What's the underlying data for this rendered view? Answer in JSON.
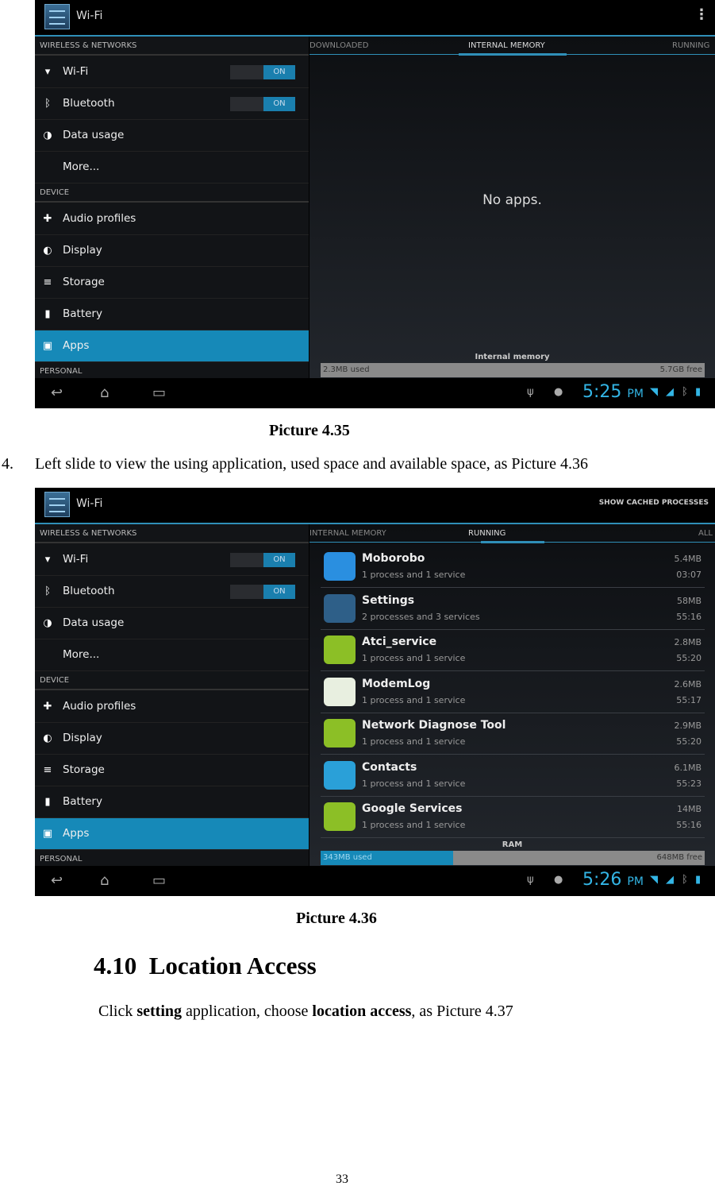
{
  "screens": [
    {
      "title": "Wi-Fi",
      "action": "⋮",
      "left_header": "WIRELESS & NETWORKS",
      "wifi": "Wi-Fi",
      "bluetooth": "Bluetooth",
      "toggle_on": "ON",
      "data_usage": "Data usage",
      "more": "More...",
      "device_header": "DEVICE",
      "audio": "Audio profiles",
      "display": "Display",
      "storage": "Storage",
      "battery": "Battery",
      "apps": "Apps",
      "personal_header": "PERSONAL",
      "tabs": [
        "DOWNLOADED",
        "INTERNAL MEMORY",
        "RUNNING"
      ],
      "selected_tab": 1,
      "empty": "No apps.",
      "bar_label": "Internal memory",
      "used": "2.3MB used",
      "free": "5.7GB free",
      "used_fraction": 0.0,
      "time": "5:25",
      "ampm": "PM"
    },
    {
      "title": "Wi-Fi",
      "action": "SHOW CACHED PROCESSES",
      "left_header": "WIRELESS & NETWORKS",
      "wifi": "Wi-Fi",
      "bluetooth": "Bluetooth",
      "toggle_on": "ON",
      "data_usage": "Data usage",
      "more": "More...",
      "device_header": "DEVICE",
      "audio": "Audio profiles",
      "display": "Display",
      "storage": "Storage",
      "battery": "Battery",
      "apps": "Apps",
      "personal_header": "PERSONAL",
      "tabs": [
        "INTERNAL MEMORY",
        "RUNNING",
        "ALL"
      ],
      "selected_tab": 1,
      "processes": [
        {
          "name": "Moborobo",
          "desc": "1 process and 1 service",
          "size": "5.4MB",
          "time": "03:07",
          "icon": "moborobo-icon",
          "color": "#2a8fe0"
        },
        {
          "name": "Settings",
          "desc": "2 processes and 3 services",
          "size": "58MB",
          "time": "55:16",
          "icon": "settings-icon",
          "color": "#2e5f88"
        },
        {
          "name": "Atci_service",
          "desc": "1 process and 1 service",
          "size": "2.8MB",
          "time": "55:20",
          "icon": "android-icon",
          "color": "#8cbf26"
        },
        {
          "name": "ModemLog",
          "desc": "1 process and 1 service",
          "size": "2.6MB",
          "time": "55:17",
          "icon": "modemlog-icon",
          "color": "#e8efe0"
        },
        {
          "name": "Network Diagnose Tool",
          "desc": "1 process and 1 service",
          "size": "2.9MB",
          "time": "55:20",
          "icon": "android-icon",
          "color": "#8cbf26"
        },
        {
          "name": "Contacts",
          "desc": "1 process and 1 service",
          "size": "6.1MB",
          "time": "55:23",
          "icon": "contacts-icon",
          "color": "#2aa0d8"
        },
        {
          "name": "Google Services",
          "desc": "1 process and 1 service",
          "size": "14MB",
          "time": "55:16",
          "icon": "android-icon",
          "color": "#8cbf26"
        }
      ],
      "bar_label": "RAM",
      "used": "343MB used",
      "free": "648MB free",
      "used_fraction": 0.346,
      "time": "5:26",
      "ampm": "PM"
    }
  ],
  "doc": {
    "caption1": "Picture 4.35",
    "step_number": "4.",
    "step_text": "Left slide to view the using application, used space and available space, as Picture 4.36",
    "caption2": "Picture 4.36",
    "section_number": "4.10",
    "section_title": "Location Access",
    "para_pre": "Click ",
    "para_b1": "setting",
    "para_mid": " application, choose ",
    "para_b2": "location access",
    "para_post": ", as Picture 4.37",
    "page_number": "33"
  },
  "colors": {
    "accent": "#33b5e5",
    "selected": "#1689b8"
  }
}
